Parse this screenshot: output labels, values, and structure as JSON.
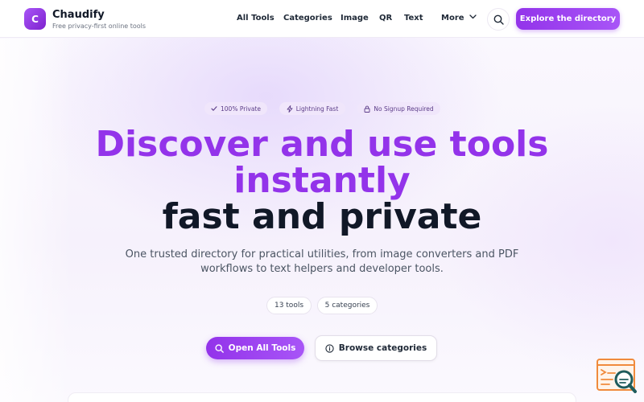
{
  "header": {
    "logo_letter": "C",
    "brand_name": "Chaudify",
    "brand_tagline": "Free privacy-first online tools",
    "nav": {
      "all_tools": "All Tools",
      "categories": "Categories",
      "image": "Image",
      "qr": "QR",
      "text": "Text",
      "more": "More"
    },
    "cta_label": "Explore the directory"
  },
  "hero": {
    "badges": {
      "private": "100% Private",
      "fast": "Lightning Fast",
      "signup": "No Signup Required"
    },
    "headline_line1": "Discover and use tools",
    "headline_line2": "instantly",
    "headline_line3": "fast and private",
    "subtitle": "One trusted directory for practical utilities, from image converters and PDF workflows to text helpers and developer tools.",
    "tools_count": "13 tools",
    "categories_count": "5 categories",
    "primary_button": "Open All Tools",
    "secondary_button": "Browse categories"
  },
  "colors": {
    "accent": "#9333ea",
    "accent_light": "#a855f7",
    "pill_bg": "#f0e6fb",
    "text_dark": "#111827",
    "fab_orange": "#f08a3c",
    "fab_teal": "#1f5c5c"
  },
  "icons": {
    "search": "search-icon",
    "chevron": "chevron-down-icon",
    "check": "check-icon",
    "bolt": "lightning-icon",
    "lock": "lock-icon",
    "info": "info-icon",
    "feedback": "feedback-search-icon"
  }
}
